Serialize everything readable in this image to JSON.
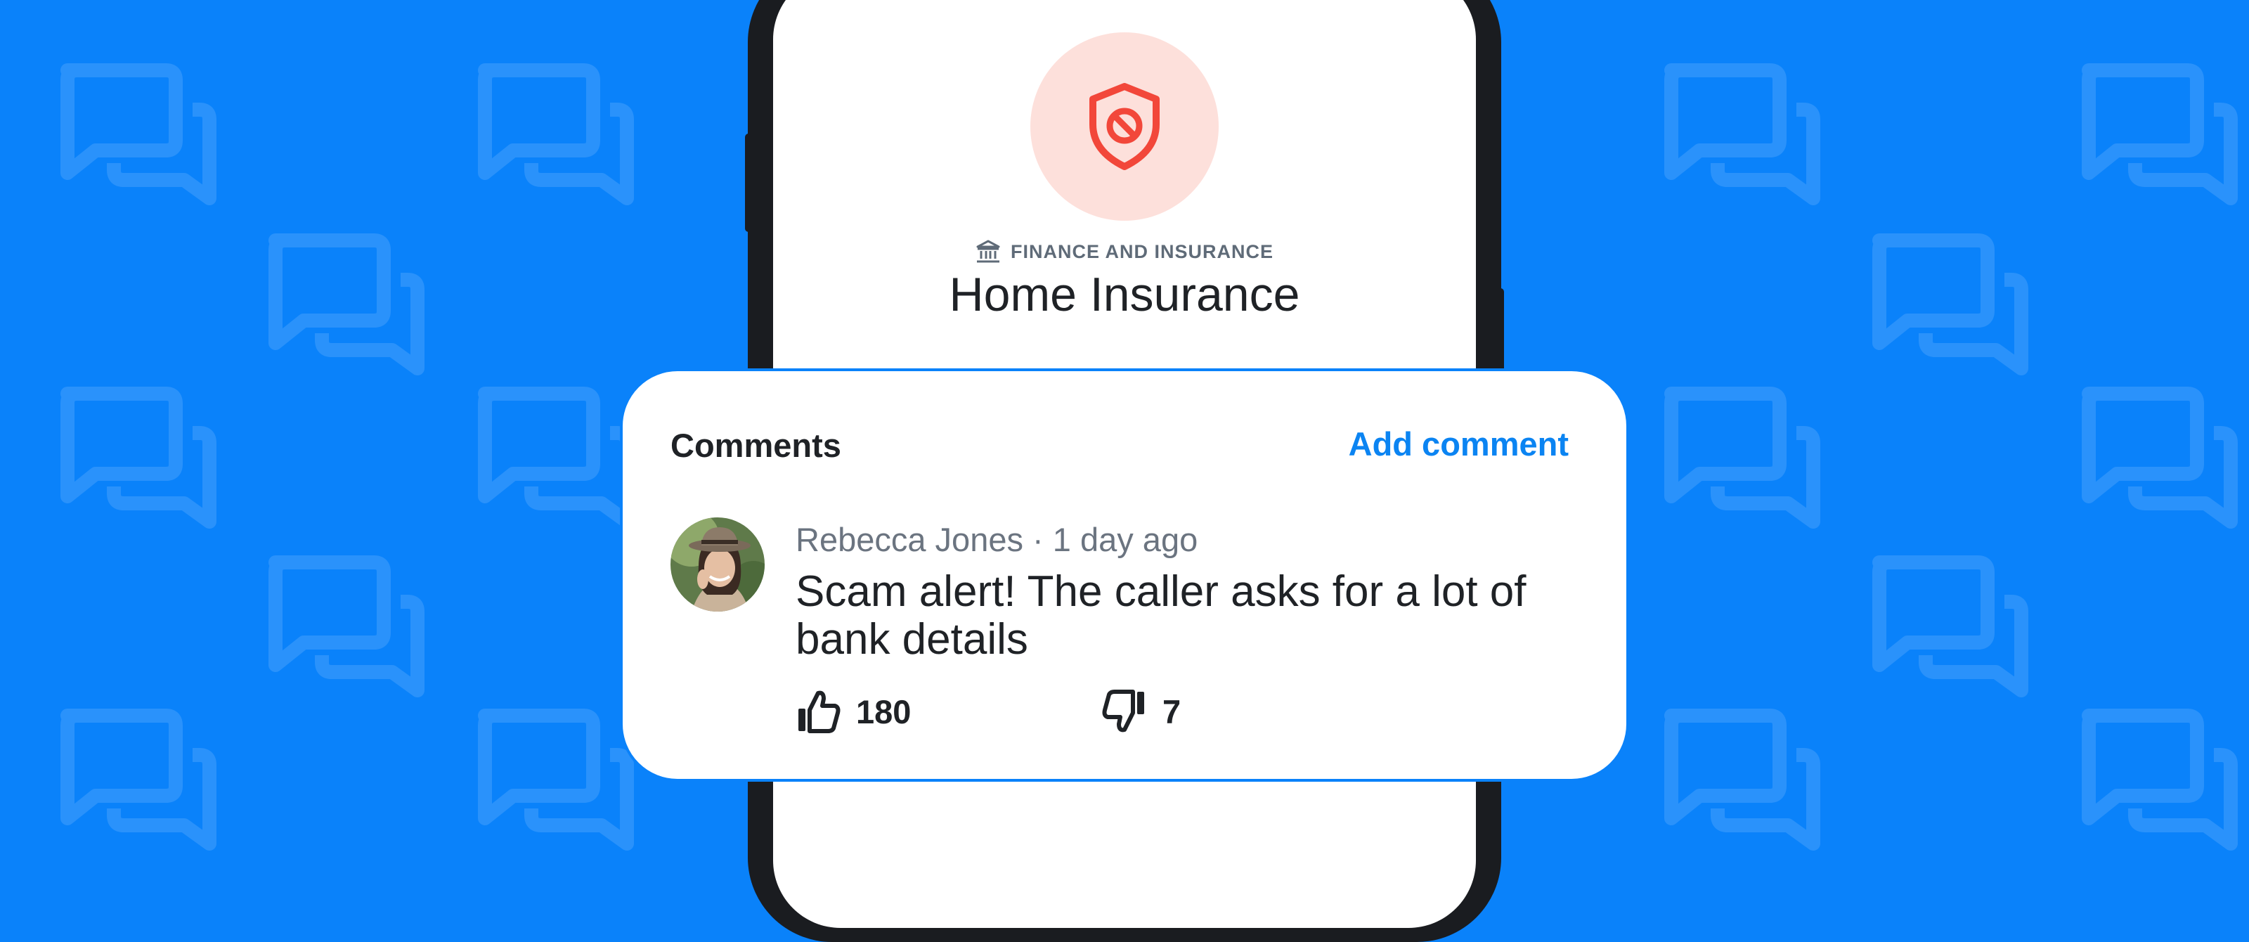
{
  "colors": {
    "background": "#0a82fa",
    "accent": "#0b84f2",
    "danger": "#f2473a",
    "danger_tint": "#fde0db"
  },
  "header": {
    "icon": "shield-block-icon",
    "category_icon": "bank-icon",
    "category": "FINANCE AND INSURANCE",
    "title": "Home Insurance"
  },
  "comments": {
    "heading": "Comments",
    "add_label": "Add comment",
    "items": [
      {
        "author": "Rebecca Jones",
        "separator": "·",
        "time": "1 day ago",
        "text": "Scam alert! The caller asks for a lot of bank details",
        "likes": "180",
        "dislikes": "7",
        "like_icon": "thumbs-up-icon",
        "dislike_icon": "thumbs-down-icon"
      }
    ]
  },
  "background_icon": "chat-bubbles-icon"
}
